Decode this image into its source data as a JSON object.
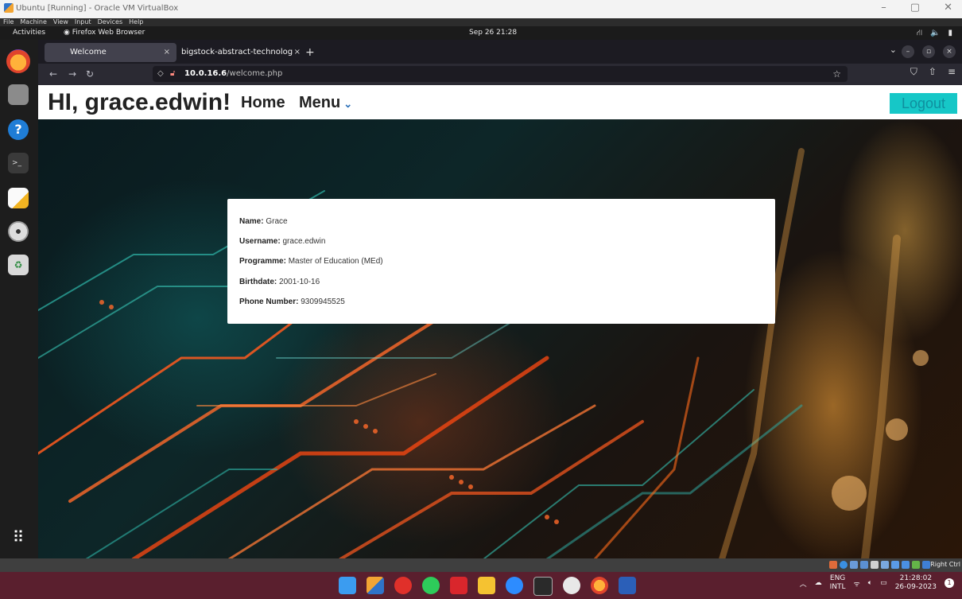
{
  "host_window": {
    "title": "Ubuntu [Running] - Oracle VM VirtualBox",
    "menu": [
      "File",
      "Machine",
      "View",
      "Input",
      "Devices",
      "Help"
    ],
    "controls": {
      "minimize": "–",
      "restore": "▢",
      "close": "✕"
    }
  },
  "gnome": {
    "activities": "Activities",
    "app_name": "Firefox Web Browser",
    "clock": "Sep 26  21:28"
  },
  "browser": {
    "tabs": [
      {
        "label": "Welcome",
        "close": "×"
      },
      {
        "label": "bigstock-abstract-technolog",
        "close": "×"
      }
    ],
    "new_tab": "+",
    "url_host": "10.0.16.6",
    "url_path": "/welcome.php"
  },
  "site": {
    "greeting": "HI, grace.edwin!",
    "nav_home": "Home",
    "nav_menu": "Menu",
    "logout": "Logout"
  },
  "profile": {
    "name_label": "Name:",
    "name_value": "Grace",
    "username_label": "Username:",
    "username_value": "grace.edwin",
    "programme_label": "Programme:",
    "programme_value": "Master of Education (MEd)",
    "birthdate_label": "Birthdate:",
    "birthdate_value": "2001-10-16",
    "phone_label": "Phone Number:",
    "phone_value": "9309945525"
  },
  "vbox_status": {
    "host_key": "Right Ctrl"
  },
  "taskbar": {
    "lang_top": "ENG",
    "lang_bottom": "INTL",
    "time": "21:28:02",
    "date": "26-09-2023"
  },
  "colors": {
    "logout_bg": "#16c7c7",
    "taskbar_bg": "#5a1f2e",
    "firefox_bg": "#1c1b22"
  }
}
